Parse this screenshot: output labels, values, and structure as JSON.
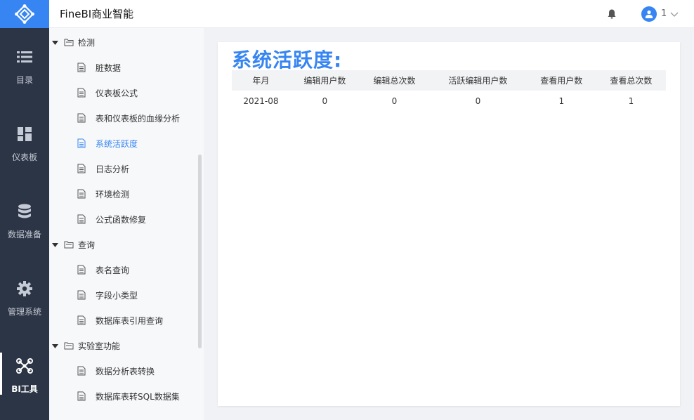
{
  "app": {
    "title": "FineBI商业智能"
  },
  "user": {
    "name": "1"
  },
  "nav": [
    {
      "label": "目录",
      "icon": "list-icon"
    },
    {
      "label": "仪表板",
      "icon": "dashboard-icon"
    },
    {
      "label": "数据准备",
      "icon": "database-icon"
    },
    {
      "label": "管理系统",
      "icon": "gear-icon"
    },
    {
      "label": "BI工具",
      "icon": "network-icon",
      "active": true
    }
  ],
  "tree": {
    "folder1": {
      "label": "检测"
    },
    "items1": [
      "脏数据",
      "仪表板公式",
      "表和仪表板的血缘分析",
      "系统活跃度",
      "日志分析",
      "环境检测",
      "公式函数修复"
    ],
    "folder2": {
      "label": "查询"
    },
    "items2": [
      "表名查询",
      "字段小类型",
      "数据库表引用查询"
    ],
    "folder3": {
      "label": "实验室功能"
    },
    "items3": [
      "数据分析表转换",
      "数据库表转SQL数据集"
    ],
    "active": "系统活跃度"
  },
  "report": {
    "title": "系统活跃度:",
    "columns": [
      "年月",
      "编辑用户数",
      "编辑总次数",
      "活跃编辑用户数",
      "查看用户数",
      "查看总次数"
    ],
    "rows": [
      [
        "2021-08",
        "0",
        "0",
        "0",
        "1",
        "1"
      ]
    ]
  },
  "colors": {
    "accent": "#3685f2",
    "nav_bg": "#2c3545"
  }
}
